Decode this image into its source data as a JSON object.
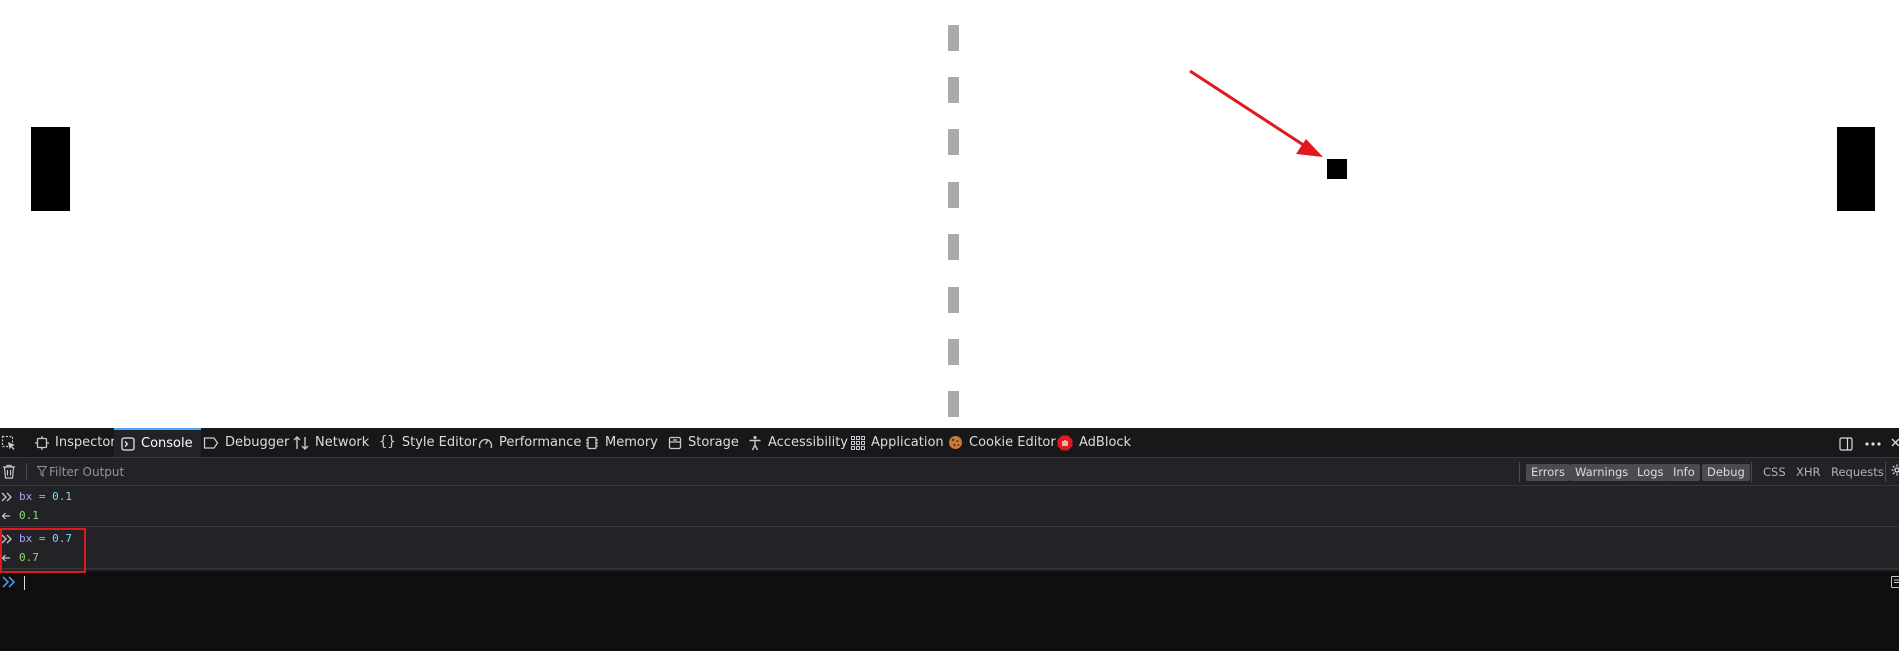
{
  "game": {
    "paddle_left": "left-paddle",
    "paddle_right": "right-paddle",
    "ball": "ball",
    "annotation_color": "#e0191e"
  },
  "devtools": {
    "tabs": [
      {
        "label": "Inspector",
        "icon": "inspector-icon"
      },
      {
        "label": "Console",
        "icon": "console-icon",
        "selected": true
      },
      {
        "label": "Debugger",
        "icon": "debugger-icon"
      },
      {
        "label": "Network",
        "icon": "network-icon"
      },
      {
        "label": "Style Editor",
        "icon": "style-editor-icon"
      },
      {
        "label": "Performance",
        "icon": "performance-icon"
      },
      {
        "label": "Memory",
        "icon": "memory-icon"
      },
      {
        "label": "Storage",
        "icon": "storage-icon"
      },
      {
        "label": "Accessibility",
        "icon": "accessibility-icon"
      },
      {
        "label": "Application",
        "icon": "application-icon"
      },
      {
        "label": "Cookie Editor",
        "icon": "cookie-icon"
      },
      {
        "label": "AdBlock",
        "icon": "adblock-icon"
      }
    ],
    "filter": {
      "placeholder": "Filter Output",
      "levels": [
        "Errors",
        "Warnings",
        "Logs",
        "Info",
        "Debug"
      ],
      "extras": [
        "CSS",
        "XHR",
        "Requests"
      ]
    },
    "messages": [
      {
        "input": {
          "var": "bx",
          "op": "=",
          "value": "0.1"
        },
        "result": "0.1"
      },
      {
        "input": {
          "var": "bx",
          "op": "=",
          "value": "0.7"
        },
        "result": "0.7"
      }
    ],
    "accent_color": "#4aa4ff"
  }
}
